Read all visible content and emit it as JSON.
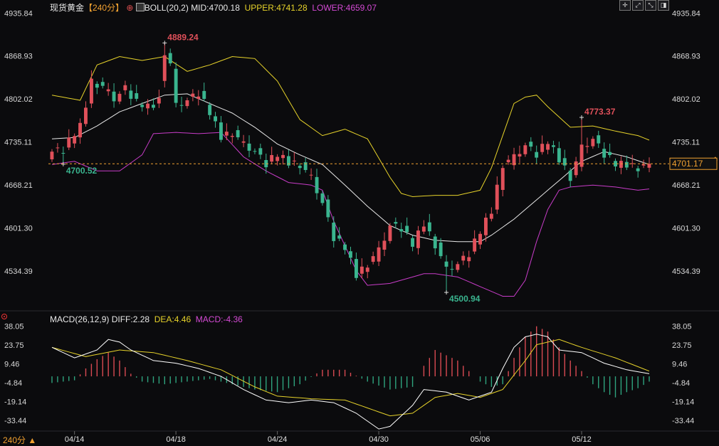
{
  "header": {
    "instrument": "现货黄金",
    "period_tag": "【240分】",
    "add_icon": "plus-circle-icon",
    "indicator_icon": "boll-indicator-icon",
    "boll_label": "BOLL(20,2)",
    "mid": "MID:4700.18",
    "upper": "UPPER:4741.28",
    "lower": "LOWER:4659.07"
  },
  "macd_header": {
    "label": "MACD(26,12,9)",
    "diff": "DIFF:2.28",
    "dea": "DEA:4.46",
    "macd": "MACD:-4.36"
  },
  "toolbar": {
    "icons": [
      "crosshair-icon",
      "zoom-in-icon",
      "zoom-out-icon",
      "settings-icon"
    ],
    "glyphs": [
      "✛",
      "⤢",
      "⤡",
      "◨"
    ]
  },
  "footer": {
    "period_selector": "240分 ▲"
  },
  "colors": {
    "up": "#e0505a",
    "down": "#3ab58f",
    "upper": "#e6d22a",
    "lower": "#c83cc8",
    "mid": "#e8e8e8",
    "diff": "#ffffff",
    "dea": "#e6d22a",
    "macd_up": "#d94a52",
    "macd_down": "#2fa47e",
    "current": "#f0a030",
    "bg": "#0b0b0d"
  },
  "chart_data": [
    {
      "type": "candlestick",
      "y_ticks": [
        4935.84,
        4868.93,
        4802.02,
        4735.11,
        4668.21,
        4601.3,
        4534.39
      ],
      "ylim": [
        4480,
        4945
      ],
      "x_ticks": [
        "04/14",
        "04/18",
        "04/24",
        "04/30",
        "05/06",
        "05/12"
      ],
      "x_tick_index": [
        4,
        22,
        40,
        58,
        76,
        94
      ],
      "current_price": 4701.17,
      "annotations": [
        {
          "text": "4889.24",
          "index": 20,
          "value": 4889.24,
          "kind": "high"
        },
        {
          "text": "4773.37",
          "index": 94,
          "value": 4773.37,
          "kind": "high"
        },
        {
          "text": "4700.52",
          "index": 2,
          "value": 4700.52,
          "kind": "low"
        },
        {
          "text": "4500.94",
          "index": 70,
          "value": 4500.94,
          "kind": "low"
        }
      ],
      "close_anchors": [
        [
          0,
          4720
        ],
        [
          2,
          4722
        ],
        [
          5,
          4760
        ],
        [
          7,
          4830
        ],
        [
          9,
          4820
        ],
        [
          11,
          4802
        ],
        [
          13,
          4818
        ],
        [
          15,
          4795
        ],
        [
          17,
          4790
        ],
        [
          19,
          4800
        ],
        [
          20,
          4870
        ],
        [
          21,
          4855
        ],
        [
          22,
          4790
        ],
        [
          24,
          4800
        ],
        [
          26,
          4810
        ],
        [
          28,
          4780
        ],
        [
          30,
          4745
        ],
        [
          32,
          4750
        ],
        [
          34,
          4730
        ],
        [
          36,
          4720
        ],
        [
          38,
          4700
        ],
        [
          40,
          4715
        ],
        [
          42,
          4705
        ],
        [
          44,
          4700
        ],
        [
          46,
          4678
        ],
        [
          48,
          4640
        ],
        [
          50,
          4585
        ],
        [
          52,
          4570
        ],
        [
          54,
          4530
        ],
        [
          56,
          4545
        ],
        [
          58,
          4565
        ],
        [
          60,
          4605
        ],
        [
          62,
          4600
        ],
        [
          64,
          4575
        ],
        [
          66,
          4610
        ],
        [
          68,
          4575
        ],
        [
          70,
          4535
        ],
        [
          72,
          4545
        ],
        [
          74,
          4560
        ],
        [
          76,
          4595
        ],
        [
          78,
          4630
        ],
        [
          80,
          4700
        ],
        [
          82,
          4710
        ],
        [
          84,
          4730
        ],
        [
          86,
          4715
        ],
        [
          88,
          4735
        ],
        [
          90,
          4710
        ],
        [
          92,
          4680
        ],
        [
          94,
          4725
        ],
        [
          96,
          4740
        ],
        [
          98,
          4715
        ],
        [
          100,
          4700
        ],
        [
          102,
          4702
        ],
        [
          104,
          4695
        ],
        [
          106,
          4701.17
        ]
      ],
      "boll_upper": [
        [
          0,
          4808
        ],
        [
          5,
          4800
        ],
        [
          8,
          4855
        ],
        [
          12,
          4868
        ],
        [
          16,
          4862
        ],
        [
          20,
          4868
        ],
        [
          24,
          4845
        ],
        [
          28,
          4855
        ],
        [
          32,
          4868
        ],
        [
          36,
          4865
        ],
        [
          40,
          4830
        ],
        [
          44,
          4770
        ],
        [
          48,
          4745
        ],
        [
          52,
          4755
        ],
        [
          56,
          4740
        ],
        [
          60,
          4680
        ],
        [
          62,
          4655
        ],
        [
          64,
          4650
        ],
        [
          68,
          4652
        ],
        [
          72,
          4652
        ],
        [
          76,
          4660
        ],
        [
          78,
          4695
        ],
        [
          80,
          4745
        ],
        [
          82,
          4795
        ],
        [
          84,
          4805
        ],
        [
          86,
          4808
        ],
        [
          88,
          4790
        ],
        [
          92,
          4758
        ],
        [
          96,
          4760
        ],
        [
          100,
          4752
        ],
        [
          104,
          4745
        ],
        [
          106,
          4738
        ]
      ],
      "boll_mid": [
        [
          0,
          4740
        ],
        [
          4,
          4742
        ],
        [
          8,
          4760
        ],
        [
          12,
          4782
        ],
        [
          16,
          4795
        ],
        [
          20,
          4808
        ],
        [
          24,
          4810
        ],
        [
          28,
          4795
        ],
        [
          32,
          4780
        ],
        [
          36,
          4758
        ],
        [
          40,
          4732
        ],
        [
          44,
          4715
        ],
        [
          48,
          4700
        ],
        [
          52,
          4668
        ],
        [
          56,
          4635
        ],
        [
          60,
          4605
        ],
        [
          64,
          4590
        ],
        [
          68,
          4582
        ],
        [
          72,
          4580
        ],
        [
          76,
          4580
        ],
        [
          78,
          4590
        ],
        [
          82,
          4615
        ],
        [
          86,
          4645
        ],
        [
          90,
          4675
        ],
        [
          94,
          4705
        ],
        [
          98,
          4720
        ],
        [
          102,
          4712
        ],
        [
          106,
          4700
        ]
      ],
      "boll_lower": [
        [
          0,
          4700
        ],
        [
          4,
          4705
        ],
        [
          8,
          4690
        ],
        [
          12,
          4690
        ],
        [
          16,
          4715
        ],
        [
          18,
          4748
        ],
        [
          22,
          4750
        ],
        [
          26,
          4748
        ],
        [
          30,
          4750
        ],
        [
          34,
          4712
        ],
        [
          38,
          4690
        ],
        [
          42,
          4672
        ],
        [
          46,
          4668
        ],
        [
          48,
          4660
        ],
        [
          50,
          4612
        ],
        [
          54,
          4535
        ],
        [
          56,
          4512
        ],
        [
          60,
          4515
        ],
        [
          64,
          4525
        ],
        [
          66,
          4530
        ],
        [
          68,
          4530
        ],
        [
          72,
          4525
        ],
        [
          76,
          4510
        ],
        [
          80,
          4495
        ],
        [
          82,
          4495
        ],
        [
          84,
          4520
        ],
        [
          86,
          4580
        ],
        [
          88,
          4630
        ],
        [
          90,
          4660
        ],
        [
          92,
          4665
        ],
        [
          96,
          4668
        ],
        [
          100,
          4665
        ],
        [
          104,
          4660
        ],
        [
          106,
          4662
        ]
      ]
    },
    {
      "type": "macd",
      "y_ticks": [
        38.05,
        23.75,
        9.46,
        -4.84,
        -19.14,
        -33.44
      ],
      "ylim": [
        -41,
        40
      ],
      "diff": [
        [
          0,
          22
        ],
        [
          4,
          14
        ],
        [
          8,
          20
        ],
        [
          10,
          28
        ],
        [
          12,
          26
        ],
        [
          14,
          20
        ],
        [
          18,
          12
        ],
        [
          22,
          10
        ],
        [
          26,
          6
        ],
        [
          30,
          0
        ],
        [
          34,
          -10
        ],
        [
          38,
          -18
        ],
        [
          42,
          -20
        ],
        [
          46,
          -18
        ],
        [
          50,
          -20
        ],
        [
          54,
          -28
        ],
        [
          58,
          -40
        ],
        [
          60,
          -38
        ],
        [
          64,
          -22
        ],
        [
          66,
          -10
        ],
        [
          70,
          -12
        ],
        [
          74,
          -18
        ],
        [
          78,
          -12
        ],
        [
          80,
          6
        ],
        [
          82,
          22
        ],
        [
          84,
          30
        ],
        [
          86,
          32
        ],
        [
          88,
          30
        ],
        [
          90,
          20
        ],
        [
          94,
          18
        ],
        [
          98,
          10
        ],
        [
          102,
          5
        ],
        [
          106,
          2
        ]
      ],
      "dea": [
        [
          0,
          22
        ],
        [
          6,
          15
        ],
        [
          12,
          20
        ],
        [
          18,
          18
        ],
        [
          24,
          12
        ],
        [
          30,
          5
        ],
        [
          36,
          -8
        ],
        [
          40,
          -15
        ],
        [
          46,
          -17
        ],
        [
          52,
          -18
        ],
        [
          56,
          -24
        ],
        [
          60,
          -30
        ],
        [
          64,
          -28
        ],
        [
          68,
          -16
        ],
        [
          72,
          -13
        ],
        [
          76,
          -16
        ],
        [
          80,
          -10
        ],
        [
          84,
          12
        ],
        [
          86,
          24
        ],
        [
          90,
          28
        ],
        [
          94,
          22
        ],
        [
          100,
          14
        ],
        [
          106,
          4
        ]
      ],
      "macd": [
        [
          0,
          -5
        ],
        [
          4,
          -3
        ],
        [
          6,
          6
        ],
        [
          8,
          13
        ],
        [
          10,
          18
        ],
        [
          12,
          12
        ],
        [
          14,
          2
        ],
        [
          16,
          -4
        ],
        [
          20,
          -6
        ],
        [
          24,
          -4
        ],
        [
          28,
          -2
        ],
        [
          32,
          -6
        ],
        [
          36,
          -10
        ],
        [
          40,
          -12
        ],
        [
          44,
          -6
        ],
        [
          48,
          5
        ],
        [
          52,
          5
        ],
        [
          56,
          -4
        ],
        [
          60,
          -10
        ],
        [
          64,
          -8
        ],
        [
          66,
          8
        ],
        [
          68,
          20
        ],
        [
          70,
          16
        ],
        [
          72,
          12
        ],
        [
          76,
          -4
        ],
        [
          78,
          -8
        ],
        [
          80,
          -6
        ],
        [
          82,
          14
        ],
        [
          84,
          30
        ],
        [
          86,
          38
        ],
        [
          88,
          34
        ],
        [
          90,
          22
        ],
        [
          92,
          12
        ],
        [
          94,
          4
        ],
        [
          96,
          -6
        ],
        [
          98,
          -12
        ],
        [
          100,
          -16
        ],
        [
          102,
          -12
        ],
        [
          104,
          -9
        ],
        [
          106,
          -4
        ]
      ]
    }
  ]
}
